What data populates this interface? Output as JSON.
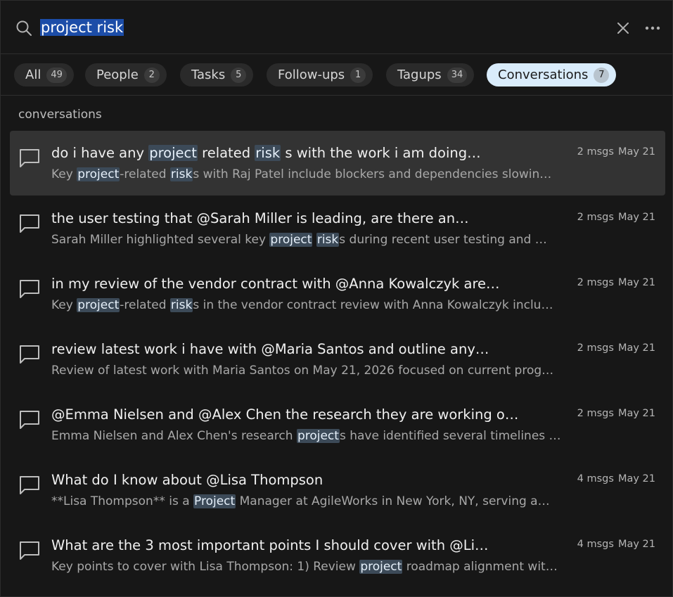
{
  "search": {
    "query": "project risk"
  },
  "filters": [
    {
      "label": "All",
      "count": "49"
    },
    {
      "label": "People",
      "count": "2"
    },
    {
      "label": "Tasks",
      "count": "5"
    },
    {
      "label": "Follow-ups",
      "count": "1"
    },
    {
      "label": "Tagups",
      "count": "34"
    },
    {
      "label": "Conversations",
      "count": "7"
    }
  ],
  "active_filter": "Conversations",
  "section_label": "conversations",
  "conversations": [
    {
      "title": [
        "do i have any ",
        {
          "hl": "project"
        },
        " related ",
        {
          "hl": "risk"
        },
        " s with the work i am doing…"
      ],
      "snippet": [
        "Key ",
        {
          "hl": "project"
        },
        "-related ",
        {
          "hl": "risk"
        },
        "s with Raj Patel include blockers and dependencies slowin…"
      ],
      "msgs": "2 msgs",
      "date": "May 21",
      "selected": true
    },
    {
      "title": [
        "the user testing that @Sarah Miller is leading, are there an…"
      ],
      "snippet": [
        "Sarah Miller highlighted several key ",
        {
          "hl": "project"
        },
        " ",
        {
          "hl": "risk"
        },
        "s during recent user testing and …"
      ],
      "msgs": "2 msgs",
      "date": "May 21",
      "selected": false
    },
    {
      "title": [
        "in my review of the vendor contract with @Anna Kowalczyk are…"
      ],
      "snippet": [
        "Key ",
        {
          "hl": "project"
        },
        "-related ",
        {
          "hl": "risk"
        },
        "s in the vendor contract review with Anna Kowalczyk inclu…"
      ],
      "msgs": "2 msgs",
      "date": "May 21",
      "selected": false
    },
    {
      "title": [
        "review latest work i have with @Maria Santos and outline any…"
      ],
      "snippet": [
        "Review of latest work with Maria Santos on May 21, 2026 focused on current prog…"
      ],
      "msgs": "2 msgs",
      "date": "May 21",
      "selected": false
    },
    {
      "title": [
        "@Emma Nielsen and @Alex Chen the research they are working o…"
      ],
      "snippet": [
        "Emma Nielsen and Alex Chen's research ",
        {
          "hl": "project"
        },
        "s have identified several timelines …"
      ],
      "msgs": "2 msgs",
      "date": "May 21",
      "selected": false
    },
    {
      "title": [
        "What do I know about @Lisa Thompson"
      ],
      "snippet": [
        "**Lisa Thompson** is a ",
        {
          "hl": "Project"
        },
        " Manager at AgileWorks in New York, NY, serving a…"
      ],
      "msgs": "4 msgs",
      "date": "May 21",
      "selected": false
    },
    {
      "title": [
        "What are the 3 most important points I should cover with @Li…"
      ],
      "snippet": [
        "Key points to cover with Lisa Thompson: 1) Review ",
        {
          "hl": "project"
        },
        " roadmap alignment wit…"
      ],
      "msgs": "4 msgs",
      "date": "May 21",
      "selected": false
    }
  ],
  "icons": {
    "search": "search-icon",
    "close": "close-icon",
    "more": "more-horizontal-icon",
    "conversation": "chat-bubble-icon"
  },
  "colors": {
    "background": "#171717",
    "selected_row": "#333333",
    "active_chip": "#d9ecfb",
    "highlight": "#3c4a58",
    "selection": "#1c4da8"
  }
}
